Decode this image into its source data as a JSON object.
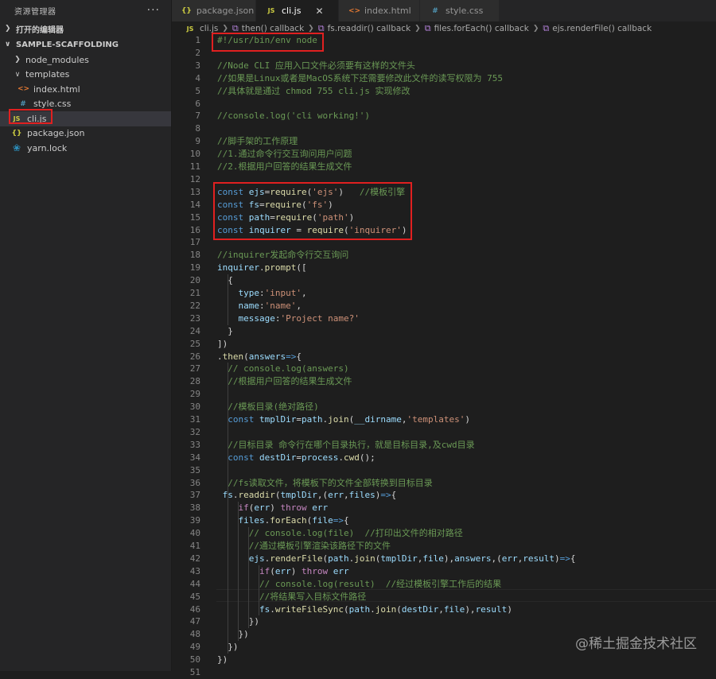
{
  "sidebar": {
    "title": "资源管理器",
    "more": "···",
    "open_editors": "打开的编辑器",
    "folder": "SAMPLE-SCAFFOLDING",
    "items": [
      {
        "label": "node_modules",
        "icon": "chevron-right-icon",
        "indent": 1
      },
      {
        "label": "templates",
        "icon": "chevron-down-icon",
        "indent": 1
      },
      {
        "label": "index.html",
        "icon": "html-file-icon",
        "indent": 2
      },
      {
        "label": "style.css",
        "icon": "css-file-icon",
        "indent": 2
      },
      {
        "label": "cli.js",
        "icon": "js-file-icon",
        "indent": 1,
        "selected": true
      },
      {
        "label": "package.json",
        "icon": "json-file-icon",
        "indent": 1
      },
      {
        "label": "yarn.lock",
        "icon": "yarn-file-icon",
        "indent": 1
      }
    ]
  },
  "tabs": [
    {
      "label": "package.json",
      "icon": "json-file-icon",
      "glyph": "{}"
    },
    {
      "label": "cli.js",
      "icon": "js-file-icon",
      "glyph": "JS",
      "active": true
    },
    {
      "label": "index.html",
      "icon": "html-file-icon",
      "glyph": "<>"
    },
    {
      "label": "style.css",
      "icon": "css-file-icon",
      "glyph": "#"
    }
  ],
  "breadcrumbs": [
    "cli.js",
    "then() callback",
    "fs.readdir() callback",
    "files.forEach() callback",
    "ejs.renderFile() callback"
  ],
  "editor": {
    "lines": [
      {
        "n": "1",
        "t": [
          [
            "c-comment",
            "#!/usr/bin/env node"
          ]
        ]
      },
      {
        "n": "2",
        "t": []
      },
      {
        "n": "3",
        "t": [
          [
            "c-comment",
            "//Node CLI 应用入口文件必须要有这样的文件头"
          ]
        ]
      },
      {
        "n": "4",
        "t": [
          [
            "c-comment",
            "//如果是Linux或者是MacOS系统下还需要修改此文件的读写权限为 755"
          ]
        ]
      },
      {
        "n": "5",
        "t": [
          [
            "c-comment",
            "//具体就是通过 chmod 755 cli.js 实现修改"
          ]
        ]
      },
      {
        "n": "6",
        "t": []
      },
      {
        "n": "7",
        "t": [
          [
            "c-comment",
            "//console.log('cli working!')"
          ]
        ]
      },
      {
        "n": "8",
        "t": []
      },
      {
        "n": "9",
        "t": [
          [
            "c-comment",
            "//脚手架的工作原理"
          ]
        ]
      },
      {
        "n": "10",
        "t": [
          [
            "c-comment",
            "//1.通过命令行交互询问用户问题"
          ]
        ]
      },
      {
        "n": "11",
        "t": [
          [
            "c-comment",
            "//2.根据用户回答的结果生成文件"
          ]
        ]
      },
      {
        "n": "12",
        "t": []
      },
      {
        "n": "13",
        "t": [
          [
            "c-kw",
            "const "
          ],
          [
            "c-var",
            "ejs"
          ],
          [
            "c-plain",
            "="
          ],
          [
            "c-fn",
            "require"
          ],
          [
            "c-plain",
            "("
          ],
          [
            "c-str",
            "'ejs'"
          ],
          [
            "c-plain",
            ")   "
          ],
          [
            "c-comment",
            "//模板引擎"
          ]
        ]
      },
      {
        "n": "14",
        "t": [
          [
            "c-kw",
            "const "
          ],
          [
            "c-var",
            "fs"
          ],
          [
            "c-plain",
            "="
          ],
          [
            "c-fn",
            "require"
          ],
          [
            "c-plain",
            "("
          ],
          [
            "c-str",
            "'fs'"
          ],
          [
            "c-plain",
            ")"
          ]
        ]
      },
      {
        "n": "15",
        "t": [
          [
            "c-kw",
            "const "
          ],
          [
            "c-var",
            "path"
          ],
          [
            "c-plain",
            "="
          ],
          [
            "c-fn",
            "require"
          ],
          [
            "c-plain",
            "("
          ],
          [
            "c-str",
            "'path'"
          ],
          [
            "c-plain",
            ")"
          ]
        ]
      },
      {
        "n": "16",
        "t": [
          [
            "c-kw",
            "const "
          ],
          [
            "c-var",
            "inquirer"
          ],
          [
            "c-plain",
            " = "
          ],
          [
            "c-fn",
            "require"
          ],
          [
            "c-plain",
            "("
          ],
          [
            "c-str",
            "'inquirer'"
          ],
          [
            "c-plain",
            ")"
          ]
        ]
      },
      {
        "n": "17",
        "t": []
      },
      {
        "n": "18",
        "t": [
          [
            "c-comment",
            "//inquirer发起命令行交互询问"
          ]
        ]
      },
      {
        "n": "19",
        "t": [
          [
            "c-var",
            "inquirer"
          ],
          [
            "c-plain",
            "."
          ],
          [
            "c-fn",
            "prompt"
          ],
          [
            "c-plain",
            "(["
          ]
        ]
      },
      {
        "n": "20",
        "t": [
          [
            "c-plain",
            "  {"
          ]
        ]
      },
      {
        "n": "21",
        "t": [
          [
            "c-plain",
            "    "
          ],
          [
            "c-var",
            "type"
          ],
          [
            "c-plain",
            ":"
          ],
          [
            "c-str",
            "'input'"
          ],
          [
            "c-plain",
            ","
          ]
        ]
      },
      {
        "n": "22",
        "t": [
          [
            "c-plain",
            "    "
          ],
          [
            "c-var",
            "name"
          ],
          [
            "c-plain",
            ":"
          ],
          [
            "c-str",
            "'name'"
          ],
          [
            "c-plain",
            ","
          ]
        ]
      },
      {
        "n": "23",
        "t": [
          [
            "c-plain",
            "    "
          ],
          [
            "c-var",
            "message"
          ],
          [
            "c-plain",
            ":"
          ],
          [
            "c-str",
            "'Project name?'"
          ]
        ]
      },
      {
        "n": "24",
        "t": [
          [
            "c-plain",
            "  }"
          ]
        ]
      },
      {
        "n": "25",
        "t": [
          [
            "c-plain",
            "])"
          ]
        ]
      },
      {
        "n": "26",
        "t": [
          [
            "c-plain",
            "."
          ],
          [
            "c-fn",
            "then"
          ],
          [
            "c-plain",
            "("
          ],
          [
            "c-var",
            "answers"
          ],
          [
            "c-kw",
            "=>"
          ],
          [
            "c-plain",
            "{"
          ]
        ]
      },
      {
        "n": "27",
        "t": [
          [
            "c-plain",
            "  "
          ],
          [
            "c-comment",
            "// console.log(answers)"
          ]
        ]
      },
      {
        "n": "28",
        "t": [
          [
            "c-plain",
            "  "
          ],
          [
            "c-comment",
            "//根据用户回答的结果生成文件"
          ]
        ]
      },
      {
        "n": "29",
        "t": []
      },
      {
        "n": "30",
        "t": [
          [
            "c-plain",
            "  "
          ],
          [
            "c-comment",
            "//模板目录(绝对路径)"
          ]
        ]
      },
      {
        "n": "31",
        "t": [
          [
            "c-plain",
            "  "
          ],
          [
            "c-kw",
            "const "
          ],
          [
            "c-var",
            "tmplDir"
          ],
          [
            "c-plain",
            "="
          ],
          [
            "c-var",
            "path"
          ],
          [
            "c-plain",
            "."
          ],
          [
            "c-fn",
            "join"
          ],
          [
            "c-plain",
            "("
          ],
          [
            "c-var",
            "__dirname"
          ],
          [
            "c-plain",
            ","
          ],
          [
            "c-str",
            "'templates'"
          ],
          [
            "c-plain",
            ")"
          ]
        ]
      },
      {
        "n": "32",
        "t": []
      },
      {
        "n": "33",
        "t": [
          [
            "c-plain",
            "  "
          ],
          [
            "c-comment",
            "//目标目录 命令行在哪个目录执行，就是目标目录,及cwd目录"
          ]
        ]
      },
      {
        "n": "34",
        "t": [
          [
            "c-plain",
            "  "
          ],
          [
            "c-kw",
            "const "
          ],
          [
            "c-var",
            "destDir"
          ],
          [
            "c-plain",
            "="
          ],
          [
            "c-var",
            "process"
          ],
          [
            "c-plain",
            "."
          ],
          [
            "c-fn",
            "cwd"
          ],
          [
            "c-plain",
            "();"
          ]
        ]
      },
      {
        "n": "35",
        "t": []
      },
      {
        "n": "36",
        "t": [
          [
            "c-plain",
            "  "
          ],
          [
            "c-comment",
            "//fs读取文件，将模板下的文件全部转换到目标目录"
          ]
        ]
      },
      {
        "n": "37",
        "t": [
          [
            "c-plain",
            " "
          ],
          [
            "c-var",
            "fs"
          ],
          [
            "c-plain",
            "."
          ],
          [
            "c-fn",
            "readdir"
          ],
          [
            "c-plain",
            "("
          ],
          [
            "c-var",
            "tmplDir"
          ],
          [
            "c-plain",
            ",("
          ],
          [
            "c-var",
            "err"
          ],
          [
            "c-plain",
            ","
          ],
          [
            "c-var",
            "files"
          ],
          [
            "c-plain",
            ")"
          ],
          [
            "c-kw",
            "=>"
          ],
          [
            "c-plain",
            "{"
          ]
        ]
      },
      {
        "n": "38",
        "t": [
          [
            "c-plain",
            "    "
          ],
          [
            "c-kw2",
            "if"
          ],
          [
            "c-plain",
            "("
          ],
          [
            "c-var",
            "err"
          ],
          [
            "c-plain",
            ") "
          ],
          [
            "c-kw2",
            "throw"
          ],
          [
            "c-plain",
            " "
          ],
          [
            "c-var",
            "err"
          ]
        ]
      },
      {
        "n": "39",
        "t": [
          [
            "c-plain",
            "    "
          ],
          [
            "c-var",
            "files"
          ],
          [
            "c-plain",
            "."
          ],
          [
            "c-fn",
            "forEach"
          ],
          [
            "c-plain",
            "("
          ],
          [
            "c-var",
            "file"
          ],
          [
            "c-kw",
            "=>"
          ],
          [
            "c-plain",
            "{"
          ]
        ]
      },
      {
        "n": "40",
        "t": [
          [
            "c-plain",
            "      "
          ],
          [
            "c-comment",
            "// console.log(file)  //打印出文件的相对路径"
          ]
        ]
      },
      {
        "n": "41",
        "t": [
          [
            "c-plain",
            "      "
          ],
          [
            "c-comment",
            "//通过模板引擎渲染该路径下的文件"
          ]
        ]
      },
      {
        "n": "42",
        "t": [
          [
            "c-plain",
            "      "
          ],
          [
            "c-var",
            "ejs"
          ],
          [
            "c-plain",
            "."
          ],
          [
            "c-fn",
            "renderFile"
          ],
          [
            "c-plain",
            "("
          ],
          [
            "c-var",
            "path"
          ],
          [
            "c-plain",
            "."
          ],
          [
            "c-fn",
            "join"
          ],
          [
            "c-plain",
            "("
          ],
          [
            "c-var",
            "tmplDir"
          ],
          [
            "c-plain",
            ","
          ],
          [
            "c-var",
            "file"
          ],
          [
            "c-plain",
            "),"
          ],
          [
            "c-var",
            "answers"
          ],
          [
            "c-plain",
            ",("
          ],
          [
            "c-var",
            "err"
          ],
          [
            "c-plain",
            ","
          ],
          [
            "c-var",
            "result"
          ],
          [
            "c-plain",
            ")"
          ],
          [
            "c-kw",
            "=>"
          ],
          [
            "c-plain",
            "{"
          ]
        ]
      },
      {
        "n": "43",
        "t": [
          [
            "c-plain",
            "        "
          ],
          [
            "c-kw2",
            "if"
          ],
          [
            "c-plain",
            "("
          ],
          [
            "c-var",
            "err"
          ],
          [
            "c-plain",
            ") "
          ],
          [
            "c-kw2",
            "throw"
          ],
          [
            "c-plain",
            " "
          ],
          [
            "c-var",
            "err"
          ]
        ]
      },
      {
        "n": "44",
        "t": [
          [
            "c-plain",
            "        "
          ],
          [
            "c-comment",
            "// console.log(result)  //经过模板引擎工作后的结果"
          ]
        ]
      },
      {
        "n": "45",
        "t": [
          [
            "c-plain",
            "        "
          ],
          [
            "c-comment",
            "//将结果写入目标文件路径"
          ]
        ]
      },
      {
        "n": "46",
        "t": [
          [
            "c-plain",
            "        "
          ],
          [
            "c-var",
            "fs"
          ],
          [
            "c-plain",
            "."
          ],
          [
            "c-fn",
            "writeFileSync"
          ],
          [
            "c-plain",
            "("
          ],
          [
            "c-var",
            "path"
          ],
          [
            "c-plain",
            "."
          ],
          [
            "c-fn",
            "join"
          ],
          [
            "c-plain",
            "("
          ],
          [
            "c-var",
            "destDir"
          ],
          [
            "c-plain",
            ","
          ],
          [
            "c-var",
            "file"
          ],
          [
            "c-plain",
            "),"
          ],
          [
            "c-var",
            "result"
          ],
          [
            "c-plain",
            ")"
          ]
        ]
      },
      {
        "n": "47",
        "t": [
          [
            "c-plain",
            "      })"
          ]
        ]
      },
      {
        "n": "48",
        "t": [
          [
            "c-plain",
            "    })"
          ]
        ]
      },
      {
        "n": "49",
        "t": [
          [
            "c-plain",
            "  })"
          ]
        ]
      },
      {
        "n": "50",
        "t": [
          [
            "c-plain",
            "})"
          ]
        ]
      },
      {
        "n": "51",
        "t": []
      }
    ]
  },
  "watermark": "@稀土掘金技术社区"
}
